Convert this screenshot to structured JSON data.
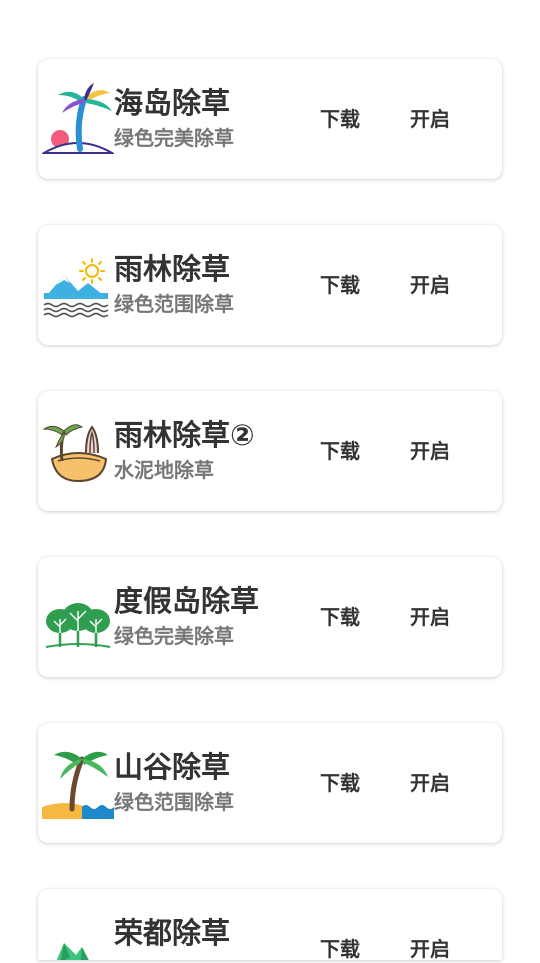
{
  "items": [
    {
      "title": "海岛除草",
      "subtitle": "绿色完美除草",
      "download_label": "下载",
      "open_label": "开启",
      "icon": "palm-island-icon"
    },
    {
      "title": "雨林除草",
      "subtitle": "绿色范围除草",
      "download_label": "下载",
      "open_label": "开启",
      "icon": "mountain-sea-icon"
    },
    {
      "title": "雨林除草②",
      "subtitle": "水泥地除草",
      "download_label": "下载",
      "open_label": "开启",
      "icon": "oasis-icon"
    },
    {
      "title": "度假岛除草",
      "subtitle": "绿色完美除草",
      "download_label": "下载",
      "open_label": "开启",
      "icon": "forest-icon"
    },
    {
      "title": "山谷除草",
      "subtitle": "绿色范围除草",
      "download_label": "下载",
      "open_label": "开启",
      "icon": "palm-beach-icon"
    },
    {
      "title": "荣都除草",
      "subtitle": "",
      "download_label": "下载",
      "open_label": "开启",
      "icon": "green-hill-icon"
    }
  ]
}
